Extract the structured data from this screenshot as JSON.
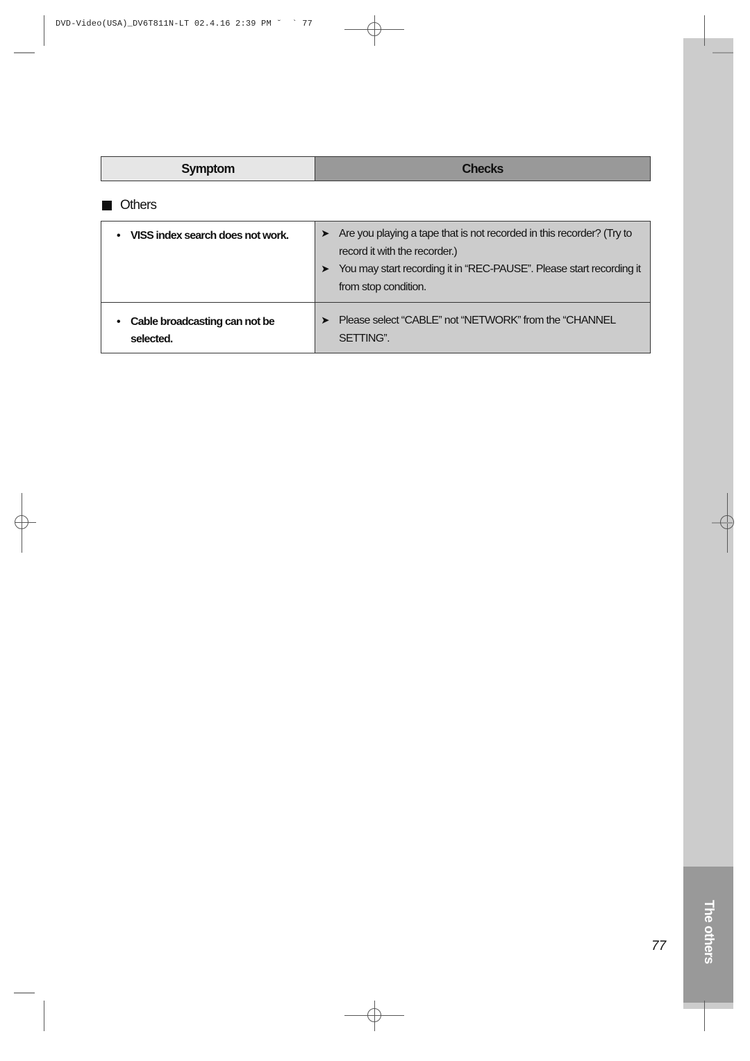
{
  "print_header": {
    "text": "DVD-Video(USA)_DV6T811N-LT 02.4.16 2:39 PM ˘  ` 77"
  },
  "table_header": {
    "symptom": "Symptom",
    "checks": "Checks"
  },
  "section": {
    "title": "Others"
  },
  "rows": [
    {
      "symptom": "VISS index search does not work.",
      "checks": [
        "Are you playing a tape that is not recorded in this recorder?  (Try to record it with the recorder.)",
        "You may start recording it in “REC-PAUSE”. Please start recording it from stop condition."
      ]
    },
    {
      "symptom": "Cable broadcasting can not be selected.",
      "checks": [
        "Please select  “CABLE” not “NETWORK” from the “CHANNEL SETTING”."
      ]
    }
  ],
  "side_tab": {
    "label": "The others"
  },
  "page_number": "77",
  "glyphs": {
    "bullet": "•",
    "arrow": "➤"
  },
  "colors": {
    "symptom_header_bg": "#e6e6e6",
    "checks_header_bg": "#999999",
    "checks_cell_bg": "#cccccc",
    "side_strip_bg": "#cccccc",
    "side_tab_bg": "#999999"
  }
}
